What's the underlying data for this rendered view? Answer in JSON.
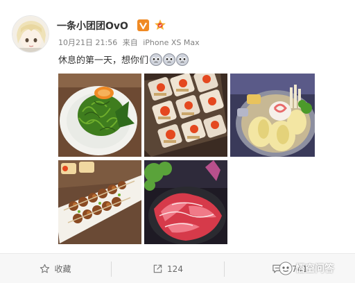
{
  "post": {
    "username": "一条小团团OvO",
    "timestamp": "10月21日 21:56",
    "source_prefix": "来自",
    "source_device": "iPhone XS Max",
    "text": "休息的第一天，想你们",
    "emoji_count": 3,
    "photos": [
      {
        "subject": "seaweed-salad"
      },
      {
        "subject": "sushi-rolls"
      },
      {
        "subject": "hotpot"
      },
      {
        "subject": "skewers"
      },
      {
        "subject": "raw-beef"
      }
    ]
  },
  "toolbar": {
    "favorite_label": "收藏",
    "forward_count": "124",
    "comment_count": "2741"
  },
  "watermark": {
    "text": "悟空问答"
  },
  "colors": {
    "verify_orange": "#f08a24",
    "toolbar_bg": "#f7f7f7",
    "text_main": "#333333",
    "text_meta": "#808080"
  }
}
